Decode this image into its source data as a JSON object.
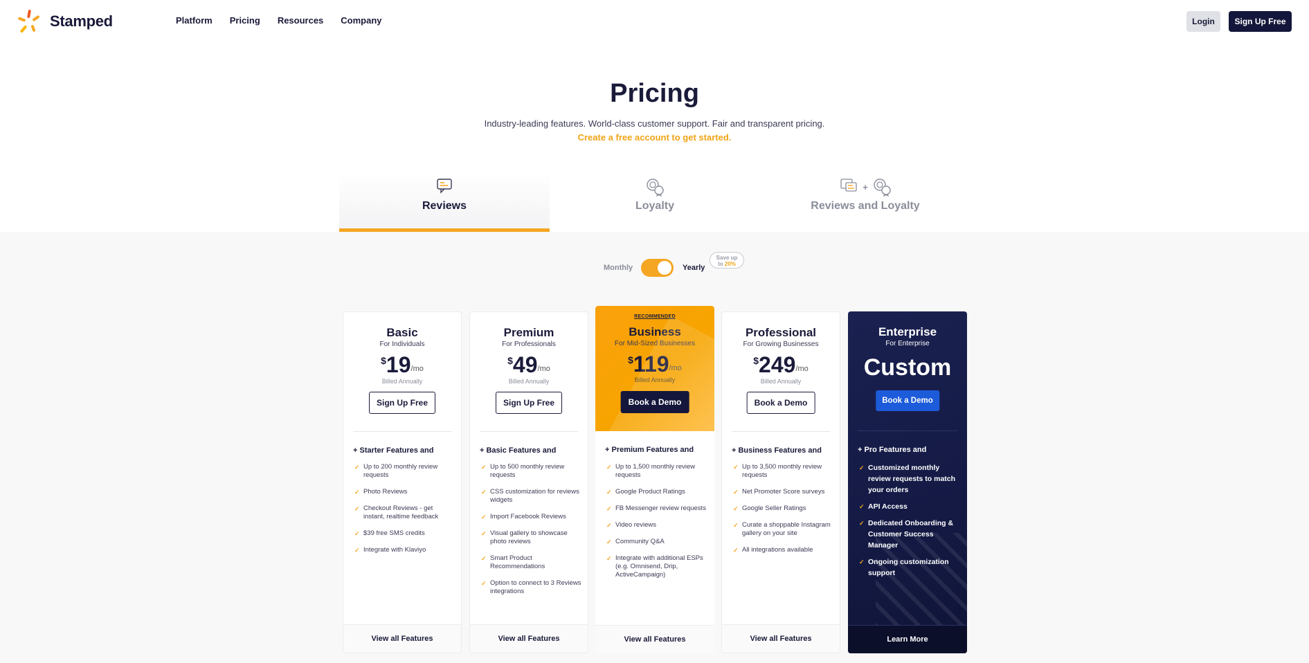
{
  "brand": {
    "name": "Stamped"
  },
  "nav": {
    "items": [
      "Platform",
      "Pricing",
      "Resources",
      "Company"
    ],
    "login": "Login",
    "signup": "Sign Up Free"
  },
  "hero": {
    "title": "Pricing",
    "subtitle": "Industry-leading features. World-class customer support. Fair and transparent pricing.",
    "cta_link": "Create a free account to get started."
  },
  "tabs": [
    {
      "label": "Reviews",
      "active": true,
      "icon": "chat-review-icon"
    },
    {
      "label": "Loyalty",
      "active": false,
      "icon": "loyalty-badge-icon"
    },
    {
      "label": "Reviews and Loyalty",
      "active": false,
      "icon": "reviews-plus-loyalty-icon",
      "plus": "+"
    }
  ],
  "billing": {
    "monthly": "Monthly",
    "yearly": "Yearly",
    "selected": "Yearly",
    "badge_line1": "Save up",
    "badge_to": "to",
    "badge_pct": "20%"
  },
  "colors": {
    "accent": "#f5a623",
    "navy": "#14173b",
    "enterprise_btn": "#1c5bd9"
  },
  "plans": [
    {
      "name": "Basic",
      "for": "For Individuals",
      "currency": "$",
      "price": "19",
      "per": "/mo",
      "billed": "Billed Annually",
      "button": "Sign Up Free",
      "features_head": "+ Starter Features and",
      "features": [
        "Up to 200 monthly review requests",
        "Photo Reviews",
        "Checkout Reviews - get instant, realtime feedback",
        "$39 free SMS credits",
        "Integrate with Klaviyo"
      ],
      "footer": "View all Features"
    },
    {
      "name": "Premium",
      "for": "For Professionals",
      "currency": "$",
      "price": "49",
      "per": "/mo",
      "billed": "Billed Annually",
      "button": "Sign Up Free",
      "features_head": "+ Basic Features and",
      "features": [
        "Up to 500 monthly review requests",
        "CSS customization for reviews widgets",
        "Import Facebook Reviews",
        "Visual gallery to showcase photo reviews",
        "Smart Product Recommendations",
        "Option to connect to 3 Reviews integrations"
      ],
      "footer": "View all Features"
    },
    {
      "name": "Business",
      "for": "For Mid-Sized Businesses",
      "recommended": "RECOMMENDED",
      "currency": "$",
      "price": "119",
      "per": "/mo",
      "billed": "Billed Annually",
      "button": "Book a Demo",
      "features_head": "+ Premium Features and",
      "features": [
        "Up to 1,500 monthly review requests",
        "Google Product Ratings",
        "FB Messenger review requests",
        "Video reviews",
        "Community Q&A",
        "Integrate with additional ESPs (e.g. Omnisend, Drip, ActiveCampaign)"
      ],
      "footer": "View all Features"
    },
    {
      "name": "Professional",
      "for": "For Growing Businesses",
      "currency": "$",
      "price": "249",
      "per": "/mo",
      "billed": "Billed Annually",
      "button": "Book a Demo",
      "features_head": "+ Business Features and",
      "features": [
        "Up to 3,500 monthly review requests",
        "Net Promoter Score surveys",
        "Google Seller Ratings",
        "Curate a shoppable Instagram gallery on your site",
        "All integrations available"
      ],
      "footer": "View all Features"
    },
    {
      "name": "Enterprise",
      "for": "For Enterprise",
      "price": "Custom",
      "button": "Book a Demo",
      "features_head": "+ Pro Features and",
      "features": [
        "Customized monthly review requests to match your orders",
        "API Access",
        "Dedicated Onboarding & Customer Success Manager",
        "Ongoing customization support"
      ],
      "footer": "Learn More"
    }
  ]
}
